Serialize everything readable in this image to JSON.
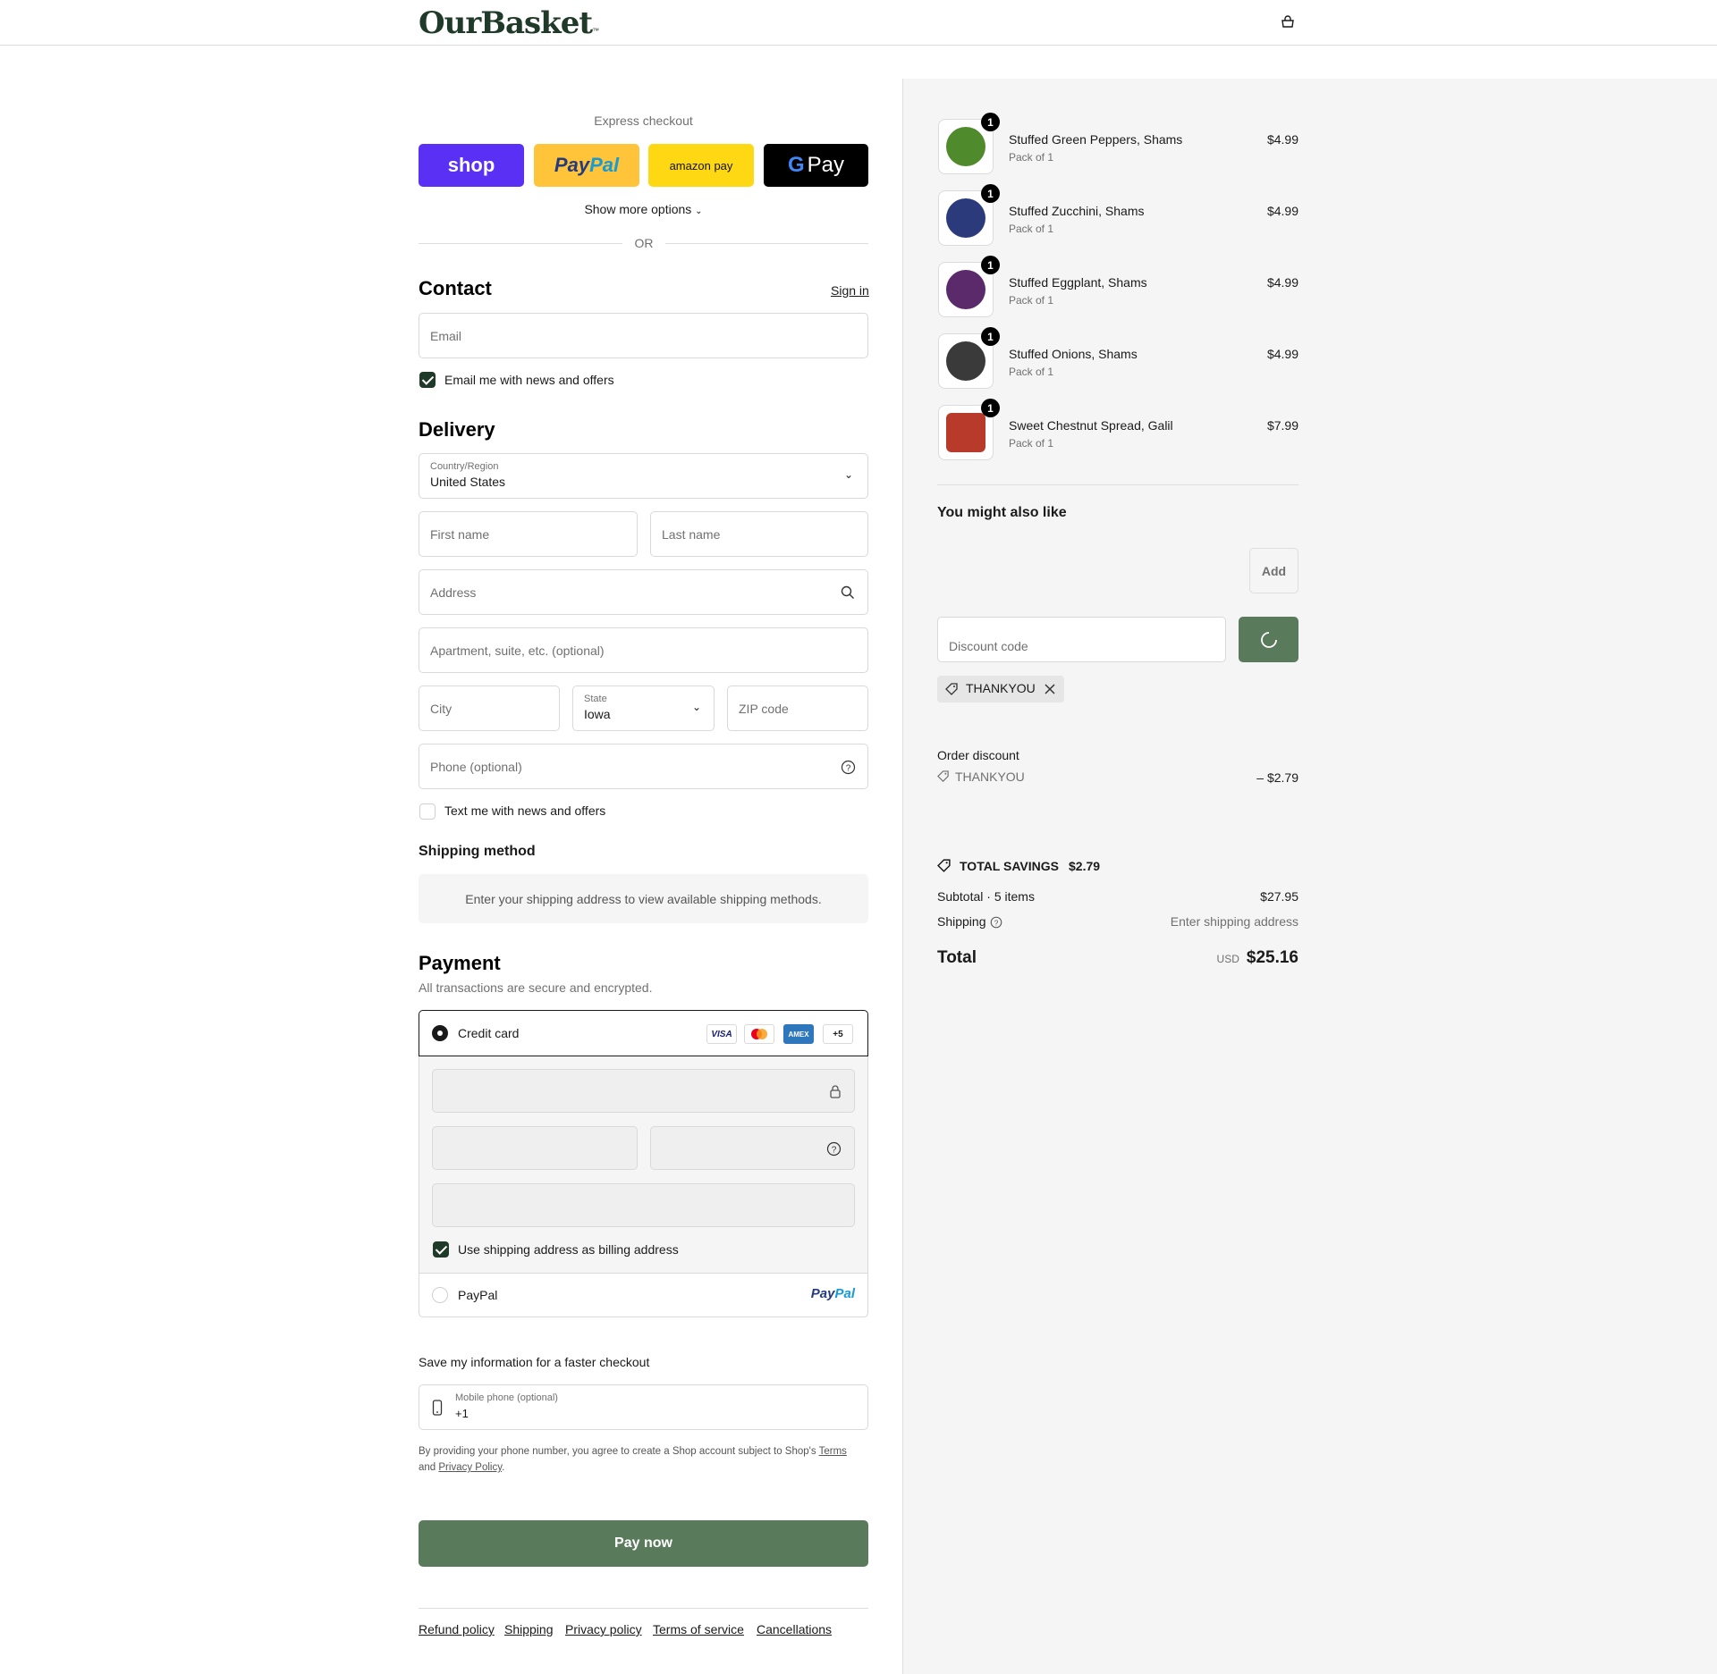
{
  "header": {
    "logo": "OurBasket",
    "logo_tm": "™"
  },
  "express": {
    "title": "Express checkout",
    "shop_label": "shop",
    "paypal_label_a": "Pay",
    "paypal_label_b": "Pal",
    "amazon_label": "amazon pay",
    "gpay_g": "G",
    "gpay_label": "Pay",
    "more": "Show more options",
    "or": "OR"
  },
  "contact": {
    "title": "Contact",
    "sign_in": "Sign in",
    "email_placeholder": "Email",
    "news_label": "Email me with news and offers"
  },
  "delivery": {
    "title": "Delivery",
    "country_label": "Country/Region",
    "country_value": "United States",
    "first_name": "First name",
    "last_name": "Last name",
    "address": "Address",
    "apartment": "Apartment, suite, etc. (optional)",
    "city": "City",
    "state_label": "State",
    "state_value": "Iowa",
    "zip": "ZIP code",
    "phone": "Phone (optional)",
    "text_label": "Text me with news and offers"
  },
  "shipping": {
    "title": "Shipping method",
    "notice": "Enter your shipping address to view available shipping methods."
  },
  "payment": {
    "title": "Payment",
    "subtitle": "All transactions are secure and encrypted.",
    "credit_card": "Credit card",
    "visa": "VISA",
    "amex": "AMEX",
    "more_cards": "+5",
    "billing_label": "Use shipping address as billing address",
    "paypal": "PayPal",
    "paypal_logo_a": "Pay",
    "paypal_logo_b": "Pal"
  },
  "save": {
    "title": "Save my information for a faster checkout",
    "phone_label": "Mobile phone (optional)",
    "phone_value": "+1",
    "legal_a": "By providing your phone number, you agree to create a Shop account subject to Shop's ",
    "terms": "Terms",
    "legal_b": "and ",
    "privacy": "Privacy Policy",
    "legal_c": "."
  },
  "pay_now": "Pay now",
  "footer": [
    "Refund policy",
    "Shipping",
    "Privacy policy",
    "Terms of service",
    "Cancellations"
  ],
  "items": [
    {
      "name": "Stuffed Green Peppers, Shams",
      "sub": "Pack of 1",
      "price": "$4.99",
      "qty": "1",
      "color": "#4f8a2c"
    },
    {
      "name": "Stuffed Zucchini, Shams",
      "sub": "Pack of 1",
      "price": "$4.99",
      "qty": "1",
      "color": "#2a3a7a"
    },
    {
      "name": "Stuffed Eggplant, Shams",
      "sub": "Pack of 1",
      "price": "$4.99",
      "qty": "1",
      "color": "#5a2a6a"
    },
    {
      "name": "Stuffed Onions, Shams",
      "sub": "Pack of 1",
      "price": "$4.99",
      "qty": "1",
      "color": "#3a3a3a"
    },
    {
      "name": "Sweet Chestnut Spread, Galil",
      "sub": "Pack of 1",
      "price": "$7.99",
      "qty": "1",
      "color": "#b83a2a"
    }
  ],
  "upsell": {
    "title": "You might also like",
    "add": "Add"
  },
  "discount": {
    "placeholder": "Discount code",
    "code": "THANKYOU"
  },
  "summary": {
    "order_discount": "Order discount",
    "discount_code": "THANKYOU",
    "discount_amount": "– $2.79",
    "total_savings_label": "TOTAL SAVINGS",
    "total_savings": "$2.79",
    "subtotal_label": "Subtotal · 5 items",
    "subtotal": "$27.95",
    "shipping_label": "Shipping",
    "shipping_value": "Enter shipping address",
    "total_label": "Total",
    "currency": "USD",
    "total": "$25.16"
  },
  "colors": {
    "brand": "#1f3a28",
    "pay_button": "#5a7a5c",
    "shop": "#5a31f4",
    "paypal": "#ffc439",
    "amazon": "#ffd814"
  }
}
